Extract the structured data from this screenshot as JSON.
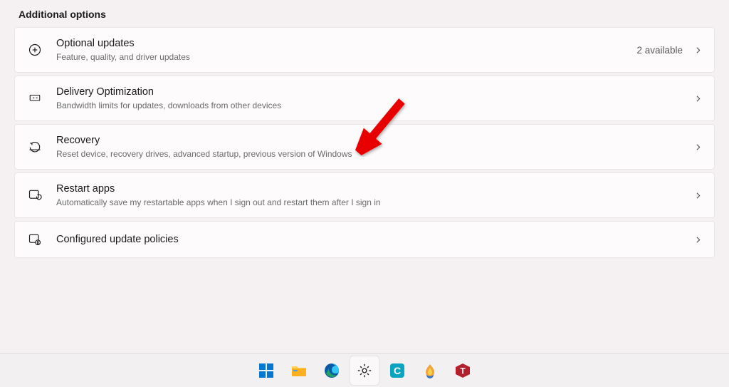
{
  "section_title": "Additional options",
  "options": [
    {
      "title": "Optional updates",
      "subtitle": "Feature, quality, and driver updates",
      "badge": "2 available"
    },
    {
      "title": "Delivery Optimization",
      "subtitle": "Bandwidth limits for updates, downloads from other devices",
      "badge": ""
    },
    {
      "title": "Recovery",
      "subtitle": "Reset device, recovery drives, advanced startup, previous version of Windows",
      "badge": ""
    },
    {
      "title": "Restart apps",
      "subtitle": "Automatically save my restartable apps when I sign out and restart them after I sign in",
      "badge": ""
    },
    {
      "title": "Configured update policies",
      "subtitle": "",
      "badge": ""
    }
  ],
  "annotation": {
    "type": "arrow",
    "color": "#e80000",
    "target": "recovery-option"
  },
  "taskbar": {
    "items": [
      {
        "name": "start",
        "label": "Start"
      },
      {
        "name": "file-explorer",
        "label": "File Explorer"
      },
      {
        "name": "edge",
        "label": "Microsoft Edge"
      },
      {
        "name": "settings",
        "label": "Settings",
        "active": true
      },
      {
        "name": "app-c",
        "label": "C App"
      },
      {
        "name": "app-flame",
        "label": "Flame App"
      },
      {
        "name": "app-t",
        "label": "T App"
      }
    ]
  }
}
